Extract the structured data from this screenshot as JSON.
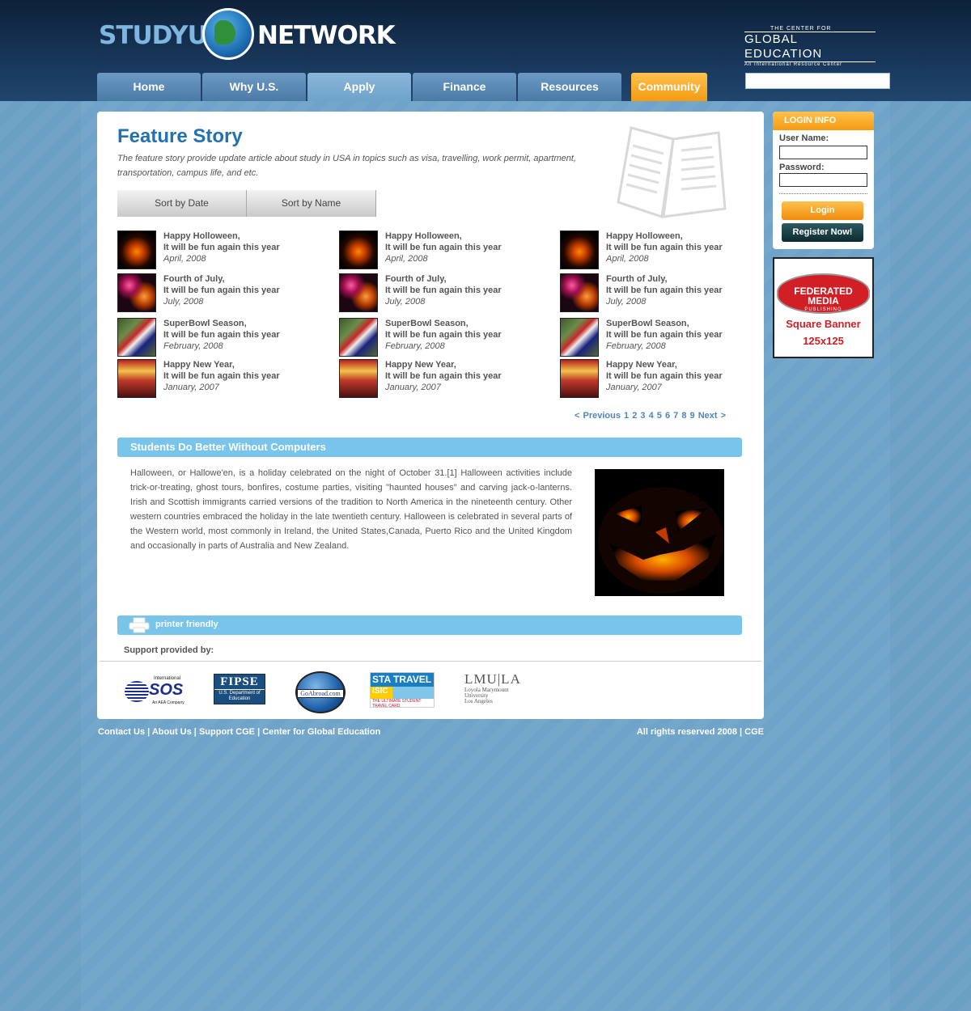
{
  "header": {
    "logo_study": "STUDYUS",
    "logo_network": "NETWORK",
    "cge_small": "THE CENTER FOR",
    "cge_big": "GLOBAL EDUCATION",
    "cge_tag": "An International Resource Center"
  },
  "nav": {
    "tabs": [
      {
        "label": "Home"
      },
      {
        "label": "Why U.S."
      },
      {
        "label": "Apply"
      },
      {
        "label": "Finance"
      },
      {
        "label": "Resources"
      },
      {
        "label": "Community"
      }
    ],
    "active": "Apply"
  },
  "search": {
    "placeholder": ""
  },
  "main": {
    "title": "Feature Story",
    "intro": "The feature story provide update article about study in USA in topics such as visa, travelling, work permit, apartment, transportation, campus life, and etc.",
    "sort": {
      "by_date": "Sort by Date",
      "by_name": "Sort by Name"
    },
    "stories": [
      {
        "title": "Happy Holloween,",
        "subtitle": "It will be fun again this year",
        "date": "April, 2008",
        "image": "halloween"
      },
      {
        "title": "Happy Holloween,",
        "subtitle": "It will be fun again this year",
        "date": "April, 2008",
        "image": "halloween"
      },
      {
        "title": "Happy Holloween,",
        "subtitle": "It will be fun again this year",
        "date": "April, 2008",
        "image": "halloween"
      },
      {
        "title": "Fourth of July,",
        "subtitle": "It will be fun again this year",
        "date": "July, 2008",
        "image": "july"
      },
      {
        "title": "Fourth of July,",
        "subtitle": "It will be fun again this year",
        "date": "July, 2008",
        "image": "july"
      },
      {
        "title": "Fourth of July,",
        "subtitle": "It will be fun again this year",
        "date": "July, 2008",
        "image": "july"
      },
      {
        "title": "SuperBowl Season,",
        "subtitle": "It will be fun again this year",
        "date": "February, 2008",
        "image": "superbowl"
      },
      {
        "title": "SuperBowl Season,",
        "subtitle": "It will be fun again this year",
        "date": "February, 2008",
        "image": "superbowl"
      },
      {
        "title": "SuperBowl Season,",
        "subtitle": "It will be fun again this year",
        "date": "February, 2008",
        "image": "superbowl"
      },
      {
        "title": "Happy New Year,",
        "subtitle": "It will be fun again this year",
        "date": "January, 2007",
        "image": "newyear"
      },
      {
        "title": "Happy New Year,",
        "subtitle": "It will be fun again this year",
        "date": "January, 2007",
        "image": "newyear"
      },
      {
        "title": "Happy New Year,",
        "subtitle": "It will be fun again this year",
        "date": "January, 2007",
        "image": "newyear"
      }
    ],
    "pager": {
      "previous": "< Previous",
      "pages": [
        "1",
        "2",
        "3",
        "4",
        "5",
        "6",
        "7",
        "8",
        "9"
      ],
      "next": "Next >"
    },
    "article": {
      "heading": "Students Do Better Without Computers",
      "body": "Halloween, or Hallowe'en, is a holiday celebrated on the night of October 31.[1] Halloween activities include trick-or-treating, ghost tours, bonfires, costume parties, visiting \"haunted houses\" and carving jack-o-lanterns. Irish and Scottish immigrants carried versions of the tradition to North America in the nineteenth century. Other western countries embraced the holiday in the late twentieth century. Halloween is celebrated in several parts of the Western world, most commonly in Ireland, the United States,Canada, Puerto Rico and the United Kingdom and occasionally in parts of Australia and New Zealand."
    },
    "printer_friendly": "printer friendly",
    "support_label": "Support provided by:",
    "sponsors": {
      "sos_top": "International",
      "sos_main": "SOS",
      "sos_sub": "An AEA Company",
      "fipse_main": "FIPSE",
      "fipse_sub": "U.S. Department of Education",
      "goabroad": "GoAbroad.com",
      "sta_main": "STA TRAVEL",
      "sta_isic": "ISIC",
      "sta_sub": "THE ULTIMATE STUDENT TRAVEL CARD",
      "lmu_main": "LMU|LA",
      "lmu_sub1": "Loyola Marymount",
      "lmu_sub2": "University",
      "lmu_sub3": "Los Angeles"
    }
  },
  "login": {
    "heading": "LOGIN INFO",
    "username_label": "User Name:",
    "password_label": "Password:",
    "login_button": "Login",
    "register_button": "Register Now!"
  },
  "banner": {
    "brand": "FEDERATED MEDIA",
    "brand_sub": "PUBLISHING",
    "line1": "Square Banner",
    "line2": "125x125"
  },
  "footer": {
    "links": [
      "Contact Us",
      "About Us",
      "Support CGE",
      "Center for Global Education"
    ],
    "separator": " | ",
    "rights": "All rights reserved 2008 | CGE"
  },
  "colors": {
    "background": "#6fa3c9",
    "header": "#1a3a5f",
    "title_blue": "#2271b0",
    "section_bar": "#78c4ea",
    "accent_orange": "#f49b12"
  },
  "icons": [
    "search-icon",
    "paper-icon",
    "printer-icon",
    "globe-icon"
  ]
}
